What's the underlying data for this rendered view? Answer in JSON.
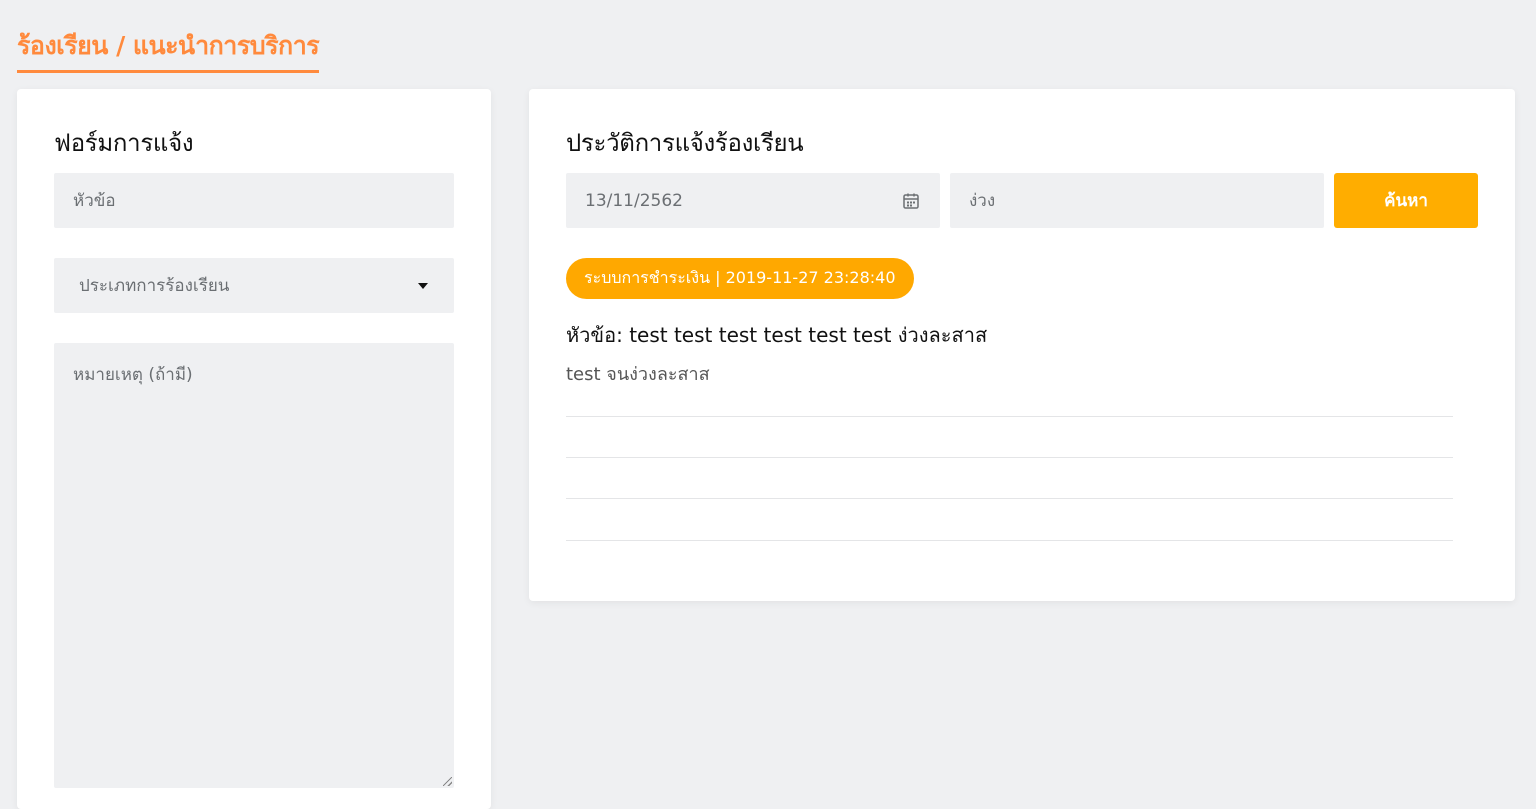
{
  "page": {
    "breadcrumb": "ร้องเรียน / แนะนำการบริการ",
    "accent_color": "#ff8a3d"
  },
  "form": {
    "heading": "ฟอร์มการแจ้ง",
    "subject_placeholder": "หัวข้อ",
    "category_selected": "ประเภทการร้องเรียน",
    "note_placeholder": "หมายเหตุ (ถ้ามี)"
  },
  "history": {
    "heading": "ประวัติการแจ้งร้องเรียน",
    "date_value": "13/11/2562",
    "keyword_value": "ง่วง",
    "search_label": "ค้นหา",
    "search_color": "#ffad00",
    "entries": [
      {
        "badge": "ระบบการชำระเงิน | 2019-11-27 23:28:40",
        "title": "หัวข้อ: test test test test test test ง่วงละสาส",
        "body": "test จนง่วงละสาส"
      }
    ]
  },
  "icons": {
    "calendar": "calendar-icon",
    "dropdown": "chevron-down-icon"
  }
}
